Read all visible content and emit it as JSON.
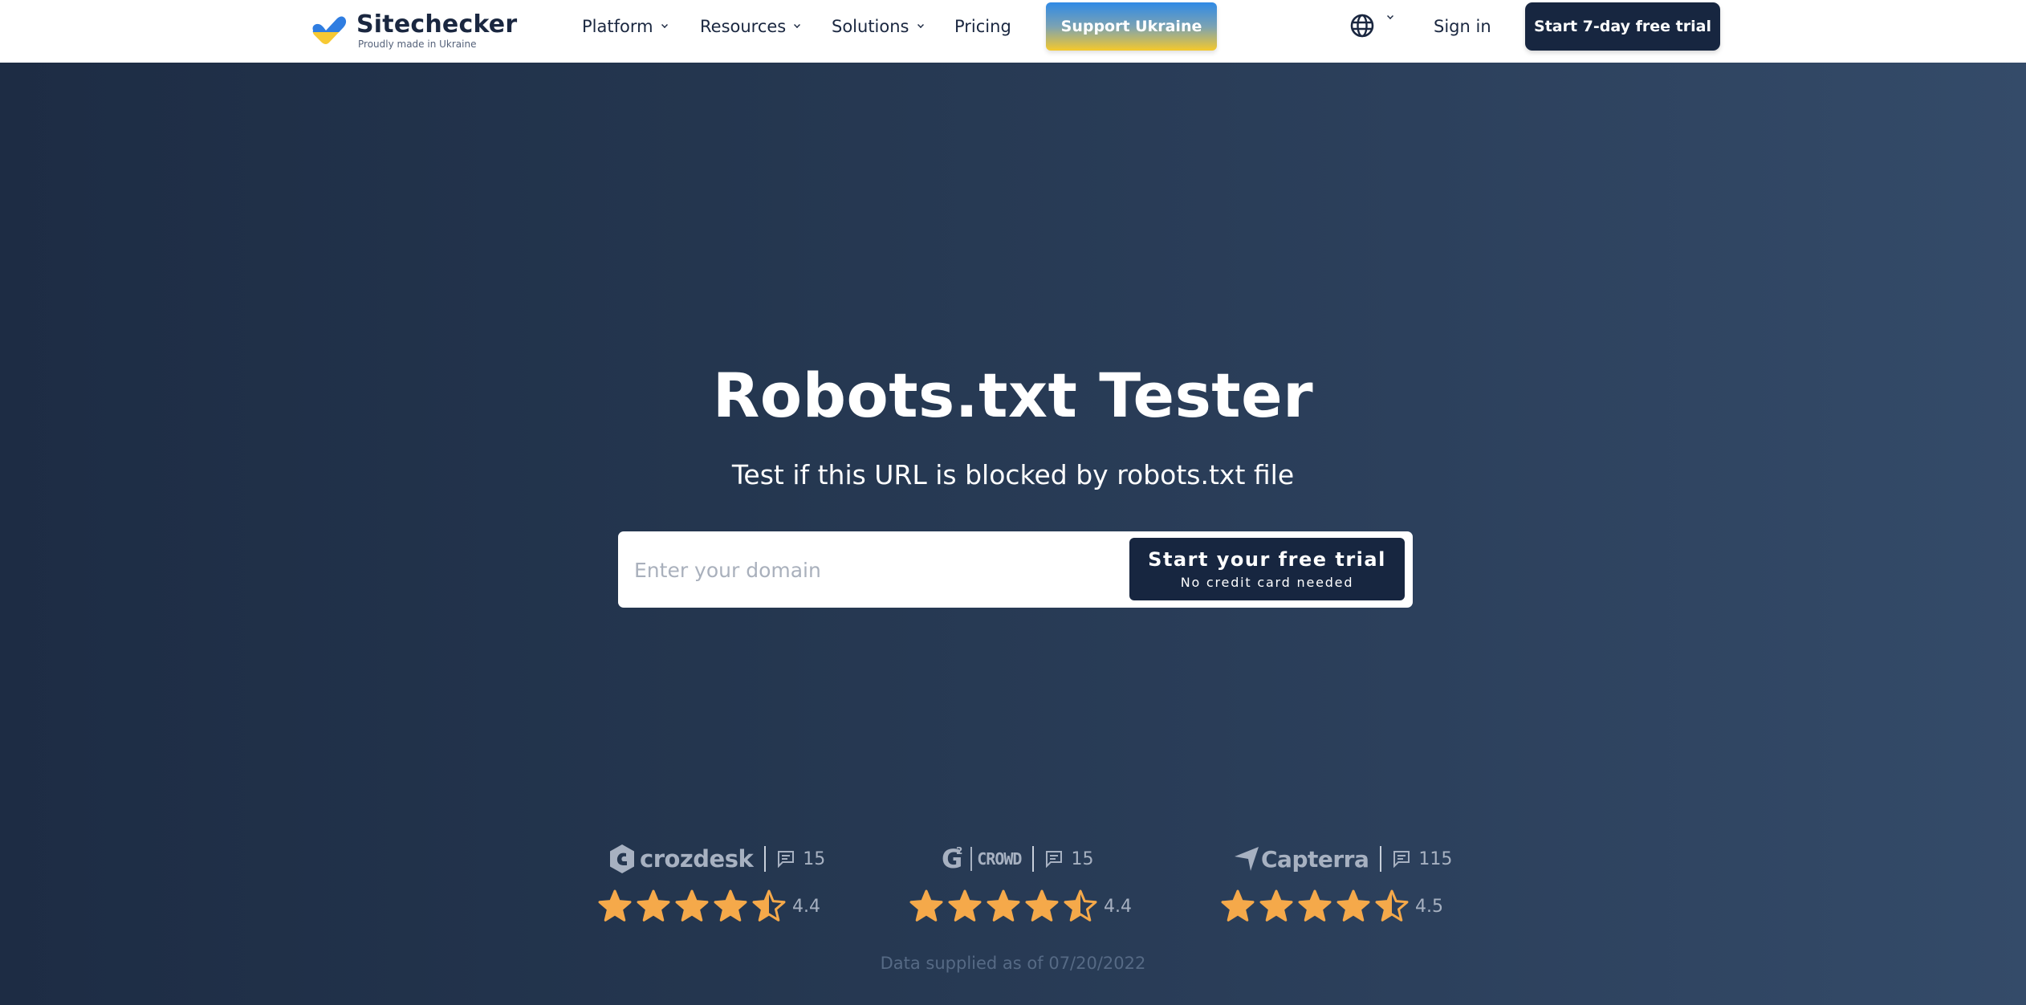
{
  "nav": {
    "logo": {
      "name": "Sitechecker",
      "tagline": "Proudly made in Ukraine"
    },
    "items": [
      {
        "label": "Platform",
        "has_dropdown": true
      },
      {
        "label": "Resources",
        "has_dropdown": true
      },
      {
        "label": "Solutions",
        "has_dropdown": true
      },
      {
        "label": "Pricing",
        "has_dropdown": false
      }
    ],
    "support_button": "Support Ukraine",
    "language_icon": "globe-icon",
    "sign_in": "Sign in",
    "trial_button": "Start 7-day free trial"
  },
  "hero": {
    "title": "Robots.txt Tester",
    "subtitle": "Test if this URL is blocked by robots.txt file",
    "search": {
      "value": "",
      "placeholder": "Enter your domain"
    },
    "cta": {
      "label": "Start your free trial",
      "sublabel": "No credit card needed"
    }
  },
  "ratings": [
    {
      "platform": "crozdesk",
      "reviews": "15",
      "score": "4.4",
      "stars": 4.4
    },
    {
      "platform": "CROWD",
      "platform_prefix": "G2",
      "reviews": "15",
      "score": "4.4",
      "stars": 4.4
    },
    {
      "platform": "Capterra",
      "reviews": "115",
      "score": "4.5",
      "stars": 4.5
    }
  ],
  "footnote": "Data supplied as of 07/20/2022",
  "colors": {
    "brand_dark": "#172640",
    "star": "#f5a94a",
    "muted": "#a7b1c1",
    "ukraine_blue": "#2f8ae6",
    "ukraine_yellow": "#f5c92c"
  }
}
